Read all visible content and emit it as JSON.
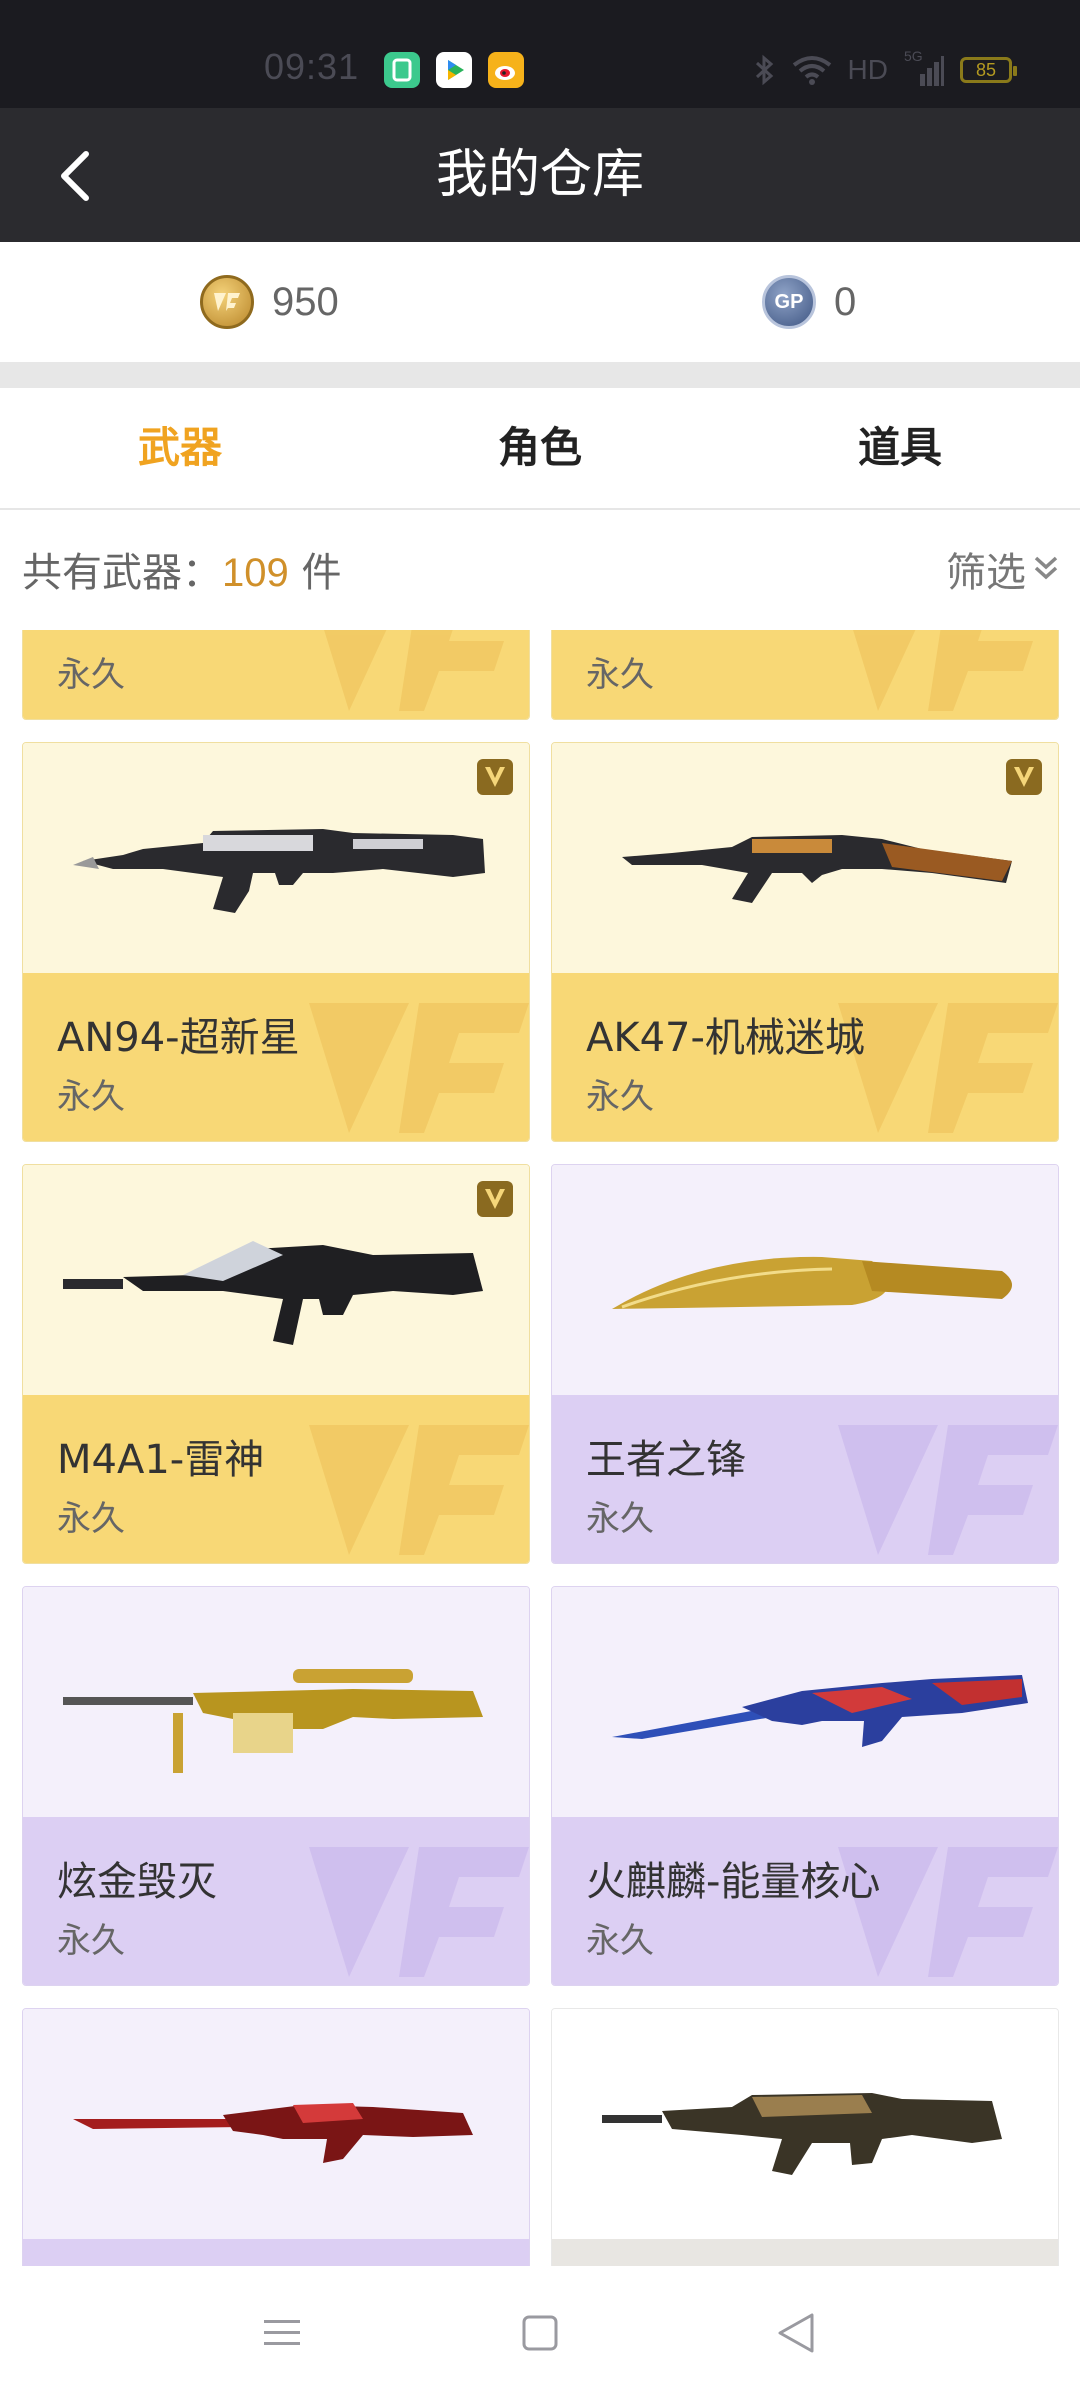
{
  "status_bar": {
    "time": "09:31",
    "network": "HD",
    "signal_label": "5G",
    "battery": "85"
  },
  "header": {
    "title": "我的仓库"
  },
  "currency": {
    "cf_points": "950",
    "gp_points": "0",
    "gp_badge": "GP"
  },
  "tabs": [
    {
      "label": "武器"
    },
    {
      "label": "角色"
    },
    {
      "label": "道具"
    }
  ],
  "summary": {
    "prefix": "共有武器：",
    "count": "109",
    "suffix": " 件"
  },
  "filter": {
    "label": "筛选"
  },
  "items": [
    {
      "name": "",
      "term": "永久",
      "rarity": "gold"
    },
    {
      "name": "",
      "term": "永久",
      "rarity": "gold"
    },
    {
      "name": "AN94-超新星",
      "term": "永久",
      "rarity": "gold",
      "vip": true
    },
    {
      "name": "AK47-机械迷城",
      "term": "永久",
      "rarity": "gold",
      "vip": true
    },
    {
      "name": "M4A1-雷神",
      "term": "永久",
      "rarity": "gold",
      "vip": true
    },
    {
      "name": "王者之锋",
      "term": "永久",
      "rarity": "purple"
    },
    {
      "name": "炫金毁灭",
      "term": "永久",
      "rarity": "purple"
    },
    {
      "name": "火麒麟-能量核心",
      "term": "永久",
      "rarity": "purple"
    },
    {
      "name": "",
      "term": "",
      "rarity": "purple"
    },
    {
      "name": "",
      "term": "",
      "rarity": "white"
    }
  ],
  "colors": {
    "accent": "#f0a320",
    "header_bg": "#2b2b2f",
    "gold_card": "#f8d876",
    "purple_card": "#dccff3"
  }
}
